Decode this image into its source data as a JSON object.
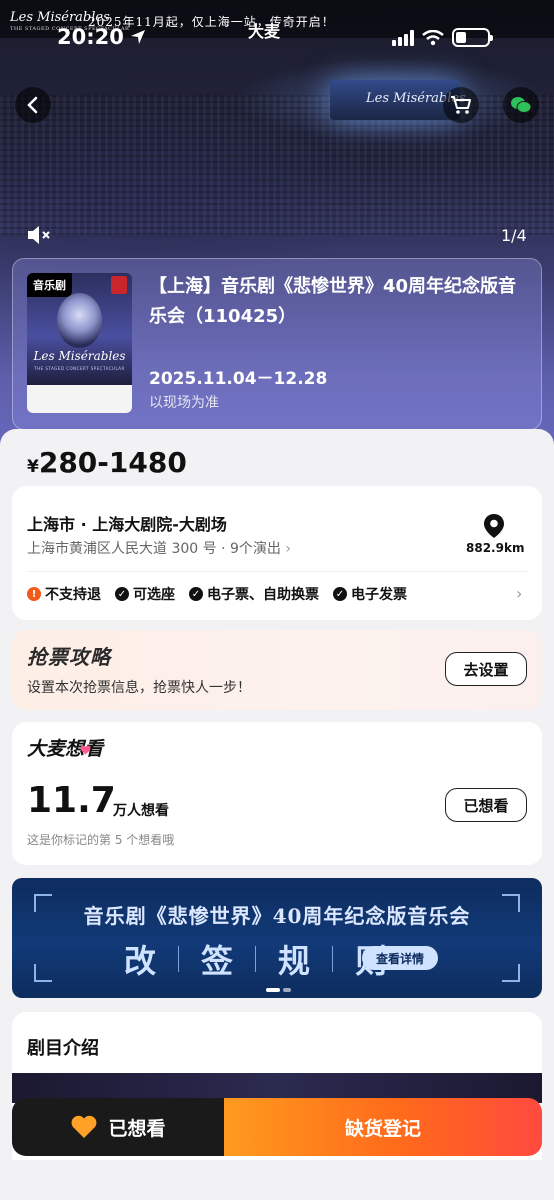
{
  "top_banner": {
    "logo": "Les Misérables",
    "logo_sub": "THE STAGED CONCERT SPECTACULAR",
    "notice": "2025年11月起，仅上海一站，传奇开启！"
  },
  "status_bar": {
    "time": "20:20",
    "brand": "大麦"
  },
  "hero": {
    "stage_text": "Les Misérables",
    "pager": "1/4"
  },
  "event": {
    "poster_tag": "音乐剧",
    "poster_title": "Les Misérables",
    "poster_sub": "THE STAGED CONCERT SPECTACULAR",
    "title": "【上海】音乐剧《悲惨世界》40周年纪念版音乐会（110425）",
    "date_range": "2025.11.04－12.28",
    "date_note": "以现场为准"
  },
  "price": {
    "currency": "¥",
    "range": "280-1480"
  },
  "venue": {
    "name": "上海市 · 上海大剧院-大剧场",
    "address": "上海市黄浦区人民大道 300 号 · 9个演出",
    "distance": "882.9km",
    "features": [
      {
        "label": "不支持退",
        "icon": "warning-icon"
      },
      {
        "label": "可选座",
        "icon": "check-icon"
      },
      {
        "label": "电子票、自助换票",
        "icon": "check-icon"
      },
      {
        "label": "电子发票",
        "icon": "check-icon"
      }
    ]
  },
  "tips": {
    "title": "抢票攻略",
    "desc": "设置本次抢票信息，抢票快人一步！",
    "button": "去设置"
  },
  "want": {
    "title": "大麦想看",
    "count": "11.7",
    "unit": "万人想看",
    "note": "这是你标记的第 5 个想看哦",
    "button": "已想看"
  },
  "banner": {
    "title": "音乐剧《悲惨世界》40周年纪念版音乐会",
    "rule_chars": [
      "改",
      "签",
      "规",
      "则"
    ],
    "button": "查看详情"
  },
  "intro": {
    "title": "剧目介绍"
  },
  "bottom_bar": {
    "wanted_label": "已想看",
    "register_label": "缺货登记"
  },
  "colors": {
    "accent_orange": "#ff6a1b",
    "warning": "#f25a1b",
    "banner_navy": "#0d2c5e"
  }
}
